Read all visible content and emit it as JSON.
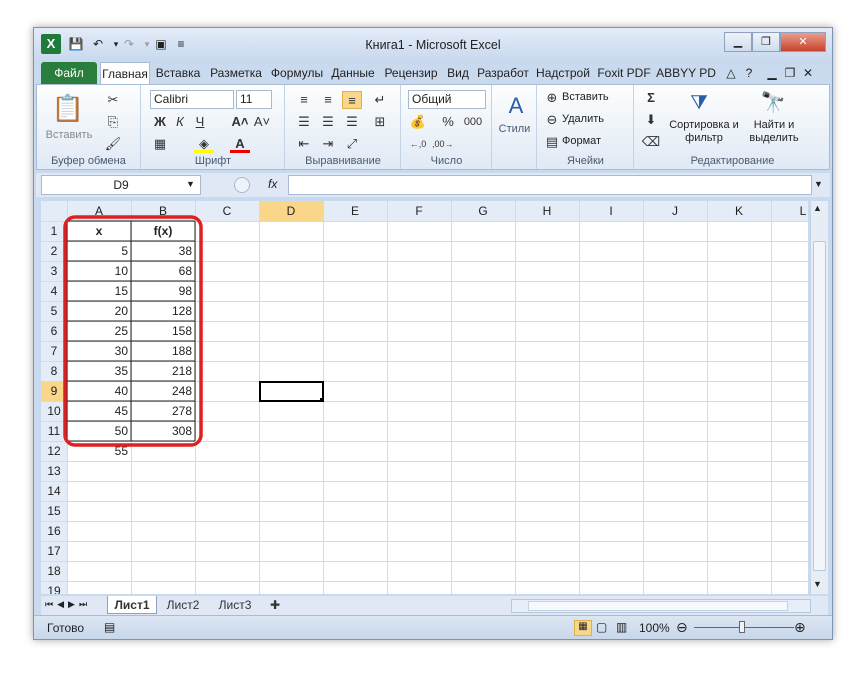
{
  "window": {
    "title": "Книга1  -  Microsoft Excel",
    "app_icon": "X"
  },
  "tabs": [
    "Файл",
    "Главная",
    "Вставка",
    "Разметка",
    "Формулы",
    "Данные",
    "Рецензир",
    "Вид",
    "Разработ",
    "Надстрой",
    "Foxit PDF",
    "ABBYY PD"
  ],
  "ribbon": {
    "clipboard": {
      "paste": "Вставить",
      "label": "Буфер обмена"
    },
    "font": {
      "name": "Calibri",
      "size": "11",
      "bold": "Ж",
      "italic": "К",
      "underline": "Ч",
      "label": "Шрифт"
    },
    "alignment": {
      "label": "Выравнивание"
    },
    "number": {
      "format": "Общий",
      "percent": "%",
      "thousands": "000",
      "label": "Число"
    },
    "styles": {
      "label": "Стили"
    },
    "cells": {
      "insert": "Вставить",
      "delete": "Удалить",
      "format": "Формат",
      "label": "Ячейки"
    },
    "editing": {
      "sort": "Сортировка и фильтр",
      "find": "Найти и выделить",
      "label": "Редактирование"
    }
  },
  "formula": {
    "namebox": "D9",
    "fx": "fx",
    "value": ""
  },
  "columns": [
    "A",
    "B",
    "C",
    "D",
    "E",
    "F",
    "G",
    "H",
    "I",
    "J",
    "K",
    "L"
  ],
  "rows": [
    "1",
    "2",
    "3",
    "4",
    "5",
    "6",
    "7",
    "8",
    "9",
    "10",
    "11",
    "12",
    "13",
    "14",
    "15",
    "16",
    "17",
    "18",
    "19"
  ],
  "headers": {
    "a": "x",
    "b": "f(x)"
  },
  "data_x": [
    "5",
    "10",
    "15",
    "20",
    "25",
    "30",
    "35",
    "40",
    "45",
    "50",
    "55"
  ],
  "data_fx": [
    "38",
    "68",
    "98",
    "128",
    "158",
    "188",
    "218",
    "248",
    "278",
    "308"
  ],
  "sheets": [
    "Лист1",
    "Лист2",
    "Лист3"
  ],
  "status": {
    "ready": "Готово",
    "zoom": "100%"
  },
  "colors": {
    "accent": "#2a7e3b",
    "highlight": "#e02020",
    "selection": "#f9d68a"
  }
}
